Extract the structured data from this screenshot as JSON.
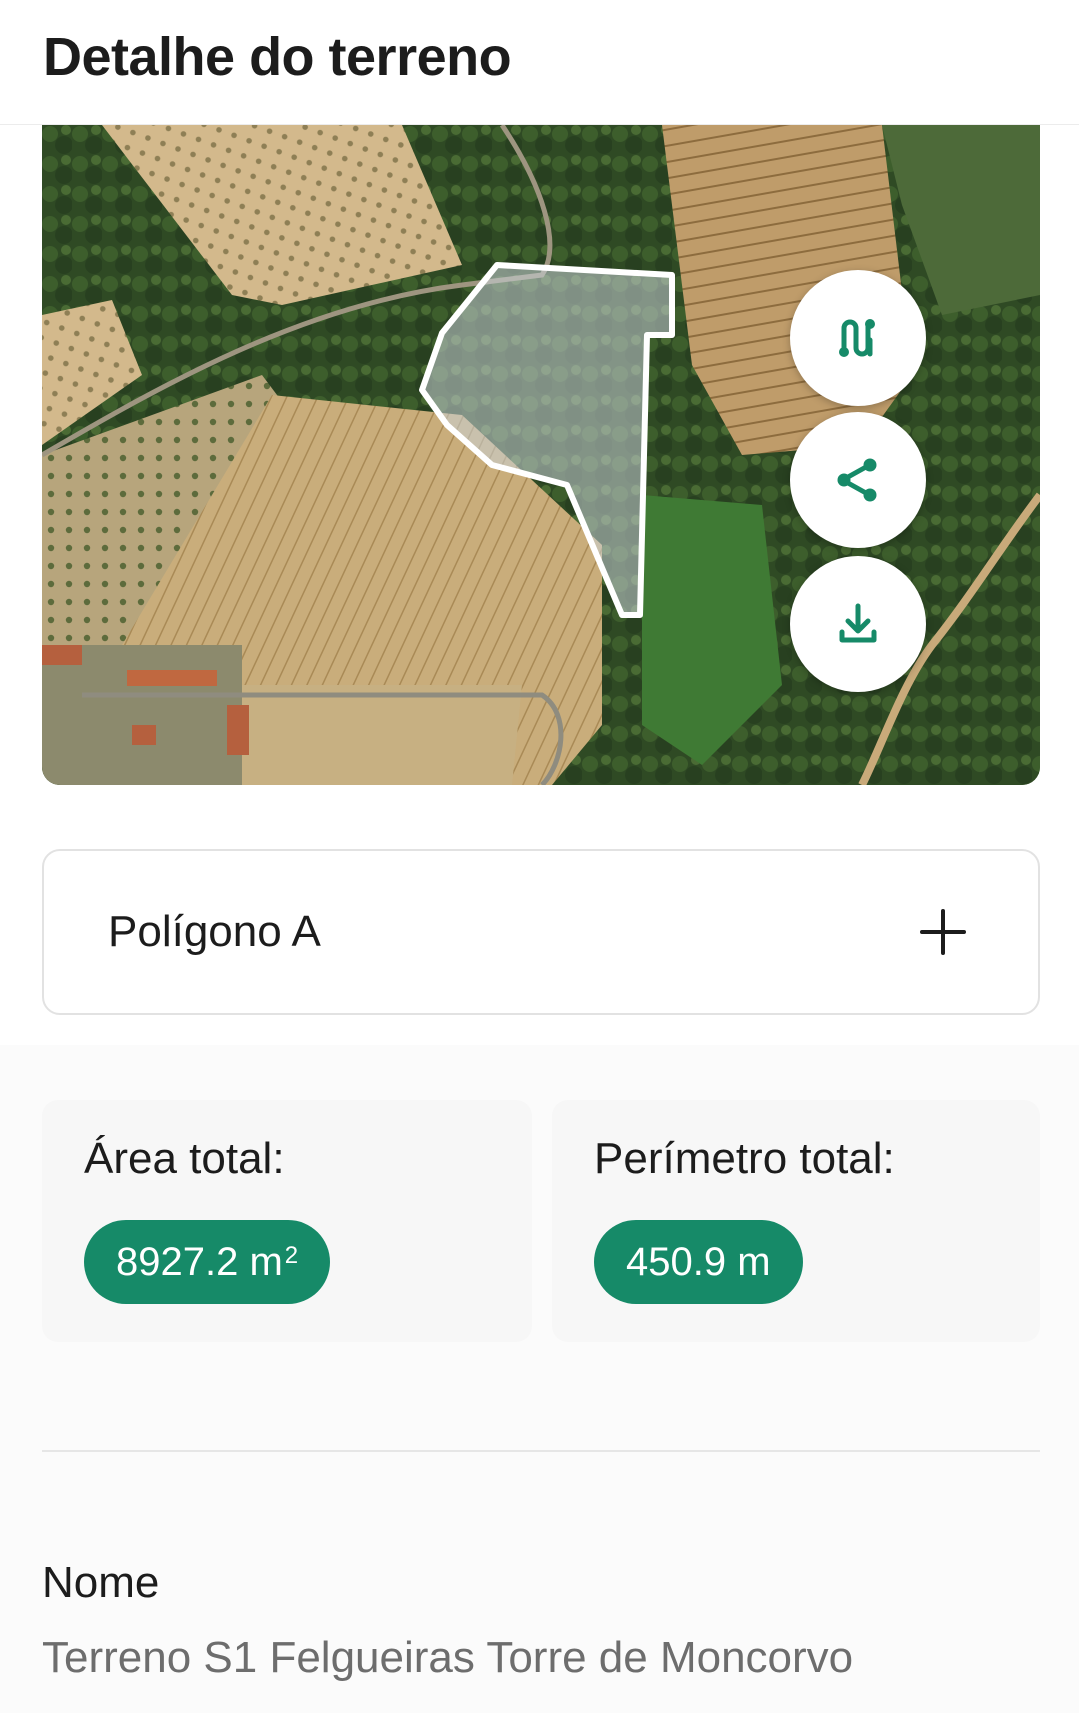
{
  "header": {
    "title": "Detalhe do terreno"
  },
  "map": {
    "actions": [
      {
        "icon": "route-icon",
        "label": "route"
      },
      {
        "icon": "share-icon",
        "label": "share"
      },
      {
        "icon": "download-icon",
        "label": "download"
      }
    ],
    "polygon_stroke": "#ffffff"
  },
  "polygon": {
    "label": "Polígono A",
    "expand_icon": "plus-icon"
  },
  "stats": {
    "area": {
      "label": "Área total:",
      "value": "8927.2 m",
      "unit_sup": "2"
    },
    "perimeter": {
      "label": "Perímetro total:",
      "value": "450.9 m"
    }
  },
  "details": {
    "name_label": "Nome",
    "name_value": "Terreno S1 Felgueiras Torre de Moncorvo"
  },
  "colors": {
    "accent": "#168a68",
    "text": "#1c1c1c",
    "muted": "#6d6d6d"
  }
}
